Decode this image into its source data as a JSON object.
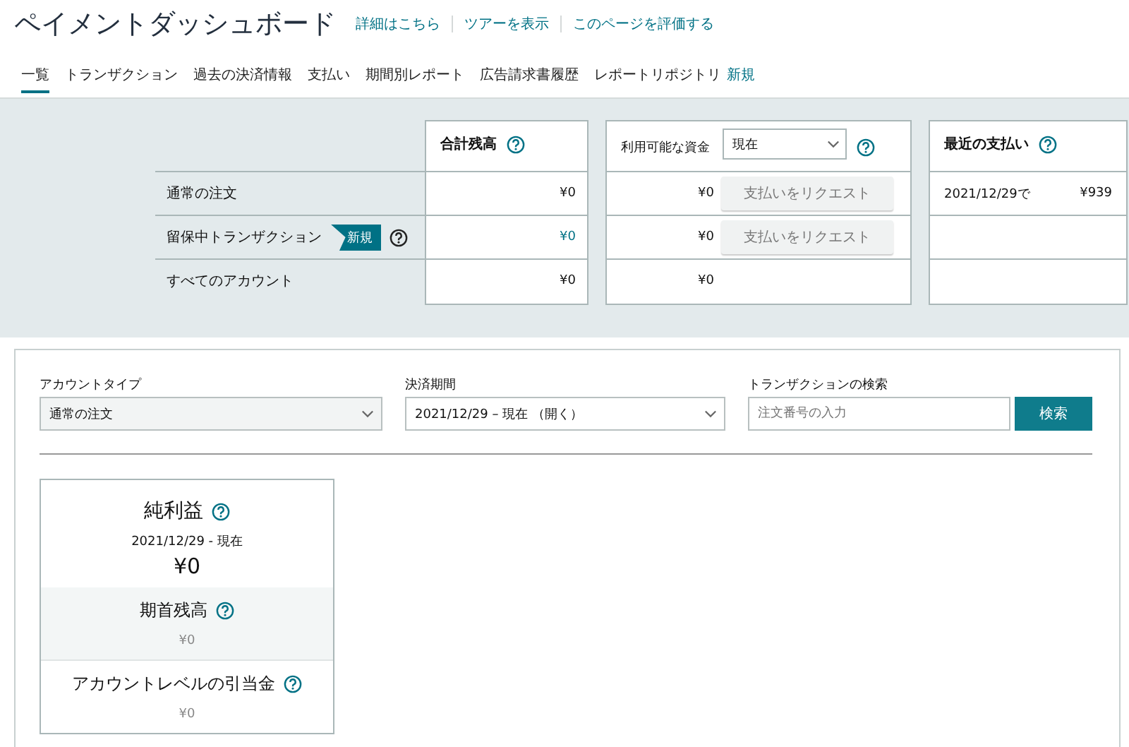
{
  "header": {
    "title": "ペイメントダッシュボード",
    "links": [
      "詳細はこちら",
      "ツアーを表示",
      "このページを評価する"
    ]
  },
  "tabs": [
    {
      "label": "一覧",
      "selected": true
    },
    {
      "label": "トランザクション",
      "selected": false
    },
    {
      "label": "過去の決済情報",
      "selected": false
    },
    {
      "label": "支払い",
      "selected": false
    },
    {
      "label": "期間別レポート",
      "selected": false
    },
    {
      "label": "広告請求書履歴",
      "selected": false
    },
    {
      "label": "レポートリポジトリ",
      "selected": false,
      "badge": "新規"
    }
  ],
  "summary": {
    "columns": [
      {
        "title": "合計残高",
        "help": true
      },
      {
        "title": "利用可能な資金",
        "dropdown": "現在",
        "help": true
      },
      {
        "title": "最近の支払い",
        "help": true
      }
    ],
    "rows": [
      {
        "label": "通常の注文",
        "total": "¥0",
        "total_link": false,
        "available": "¥0",
        "request_button": {
          "label": "支払いをリクエスト",
          "disabled": true
        },
        "recent_date": "2021/12/29で",
        "recent_amount": "¥939"
      },
      {
        "label": "留保中トランザクション",
        "badge": "新規",
        "help": true,
        "total": "¥0",
        "total_link": true,
        "available": "¥0",
        "request_button": {
          "label": "支払いをリクエスト",
          "disabled": true
        }
      },
      {
        "label": "すべてのアカウント",
        "total": "¥0",
        "total_link": false,
        "available": "¥0"
      }
    ]
  },
  "filters": {
    "account_type": {
      "label": "アカウントタイプ",
      "value": "通常の注文"
    },
    "period": {
      "label": "決済期間",
      "value": "2021/12/29 – 現在 （開く）"
    },
    "search": {
      "label": "トランザクションの検索",
      "placeholder": "注文番号の入力",
      "button": "検索"
    }
  },
  "net_income": {
    "title": "純利益",
    "help": true,
    "range": "2021/12/29 - 現在",
    "amount": "¥0",
    "sections": [
      {
        "title": "期首残高",
        "help": true,
        "amount": "¥0"
      },
      {
        "title": "アカウントレベルの引当金",
        "help": true,
        "amount": "¥0"
      }
    ]
  }
}
